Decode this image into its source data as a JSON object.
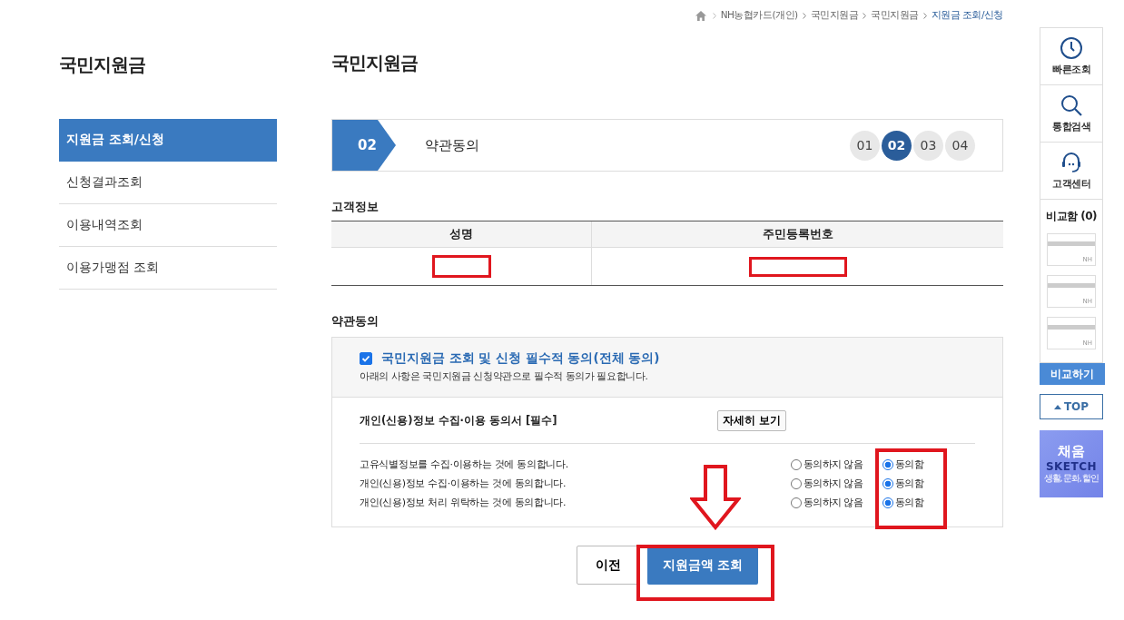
{
  "breadcrumb": [
    {
      "label": "NH농협카드(개인)",
      "current": false
    },
    {
      "label": "국민지원금",
      "current": false
    },
    {
      "label": "국민지원금",
      "current": false
    },
    {
      "label": "지원금 조회/신청",
      "current": true
    }
  ],
  "sidebar": {
    "title": "국민지원금",
    "items": [
      {
        "label": "지원금 조회/신청",
        "selected": true
      },
      {
        "label": "신청결과조회",
        "selected": false
      },
      {
        "label": "이용내역조회",
        "selected": false
      },
      {
        "label": "이용가맹점 조회",
        "selected": false
      }
    ]
  },
  "page_title": "국민지원금",
  "step": {
    "number": "02",
    "label": "약관동의",
    "steps": [
      {
        "label": "01",
        "selected": false
      },
      {
        "label": "02",
        "selected": true
      },
      {
        "label": "03",
        "selected": false
      },
      {
        "label": "04",
        "selected": false
      }
    ]
  },
  "customer_info": {
    "title": "고객정보",
    "columns": [
      "성명",
      "주민등록번호"
    ],
    "cells": [
      {
        "redacted": true
      },
      {
        "redacted": true
      }
    ]
  },
  "terms": {
    "title": "약관동의",
    "all_agree": {
      "checked": true,
      "label": "국민지원금 조회 및 신청 필수적 동의(전체 동의)",
      "note": "아래의 사항은 국민지원금 신청약관으로 필수적 동의가 필요합니다."
    },
    "section_title": "개인(신용)정보 수집·이용 동의서 [필수]",
    "detail_button": "자세히 보기",
    "items": [
      {
        "text": "고유식별정보를 수집·이용하는 것에 동의합니다.",
        "options": [
          {
            "label": "동의하지 않음",
            "selected": false
          },
          {
            "label": "동의함",
            "selected": true
          }
        ]
      },
      {
        "text": "개인(신용)정보 수집·이용하는 것에 동의합니다.",
        "options": [
          {
            "label": "동의하지 않음",
            "selected": false
          },
          {
            "label": "동의함",
            "selected": true
          }
        ]
      },
      {
        "text": "개인(신용)정보 처리 위탁하는 것에 동의합니다.",
        "options": [
          {
            "label": "동의하지 않음",
            "selected": false
          },
          {
            "label": "동의함",
            "selected": true
          }
        ]
      }
    ]
  },
  "buttons": [
    {
      "label": "이전",
      "kind": "secondary"
    },
    {
      "label": "지원금액 조회",
      "kind": "primary"
    }
  ],
  "quick_menu": {
    "items": [
      {
        "label": "빠른조회",
        "kind": "clock"
      },
      {
        "label": "통합검색",
        "kind": "search"
      },
      {
        "label": "고객센터",
        "kind": "headset"
      }
    ],
    "compare_title": "비교함 (0)",
    "compare_cards": [
      "NH",
      "NH",
      "NH"
    ],
    "compare_button": "비교하기",
    "top_button": "TOP",
    "banner": {
      "title": "채움",
      "subtitle": "SKETCH",
      "caption": "생활, 문화, 할인"
    }
  }
}
